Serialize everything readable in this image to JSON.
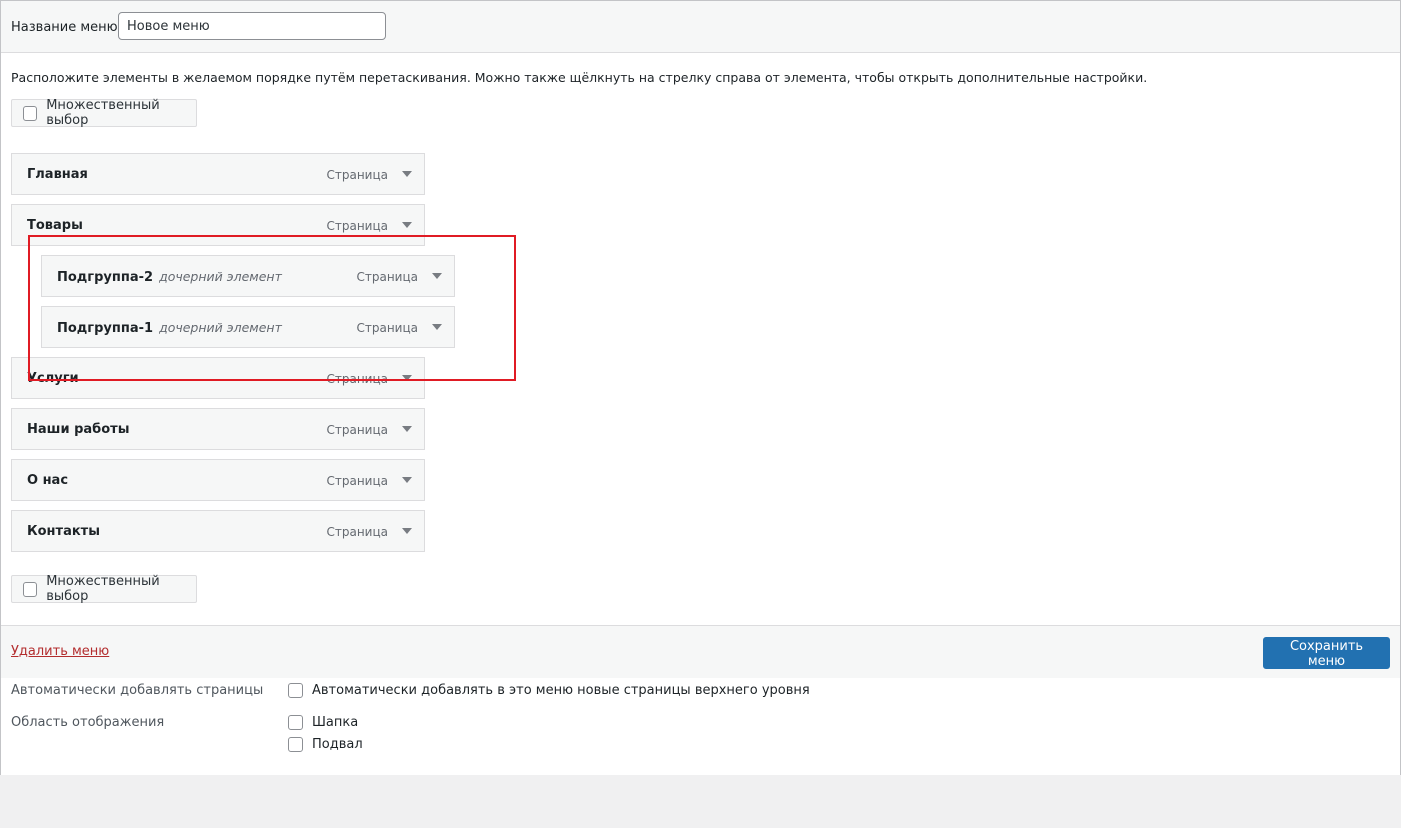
{
  "header": {
    "menu_name_label": "Название меню",
    "menu_name_value": "Новое меню"
  },
  "instructions": "Расположите элементы в желаемом порядке путём перетаскивания. Можно также щёлкнуть на стрелку справа от элемента, чтобы открыть дополнительные настройки.",
  "bulk_select_label": "Множественный выбор",
  "menu_items": [
    {
      "title": "Главная",
      "type": "Страница",
      "sub_note": ""
    },
    {
      "title": "Товары",
      "type": "Страница",
      "sub_note": ""
    },
    {
      "title": "Подгруппа-2",
      "type": "Страница",
      "sub_note": "дочерний элемент"
    },
    {
      "title": "Подгруппа-1",
      "type": "Страница",
      "sub_note": "дочерний элемент"
    },
    {
      "title": "Услуги",
      "type": "Страница",
      "sub_note": ""
    },
    {
      "title": "Наши работы",
      "type": "Страница",
      "sub_note": ""
    },
    {
      "title": "О нас",
      "type": "Страница",
      "sub_note": ""
    },
    {
      "title": "Контакты",
      "type": "Страница",
      "sub_note": ""
    }
  ],
  "footer": {
    "delete_link": "Удалить меню",
    "save_button": "Сохранить меню"
  },
  "settings": {
    "auto_add_label": "Автоматически добавлять страницы",
    "auto_add_option": "Автоматически добавлять в это меню новые страницы верхнего уровня",
    "display_location_label": "Область отображения",
    "location_header": "Шапка",
    "location_footer": "Подвал"
  },
  "colors": {
    "accent": "#2271b1",
    "delete": "#b32d2e",
    "highlight": "#e01b24"
  }
}
